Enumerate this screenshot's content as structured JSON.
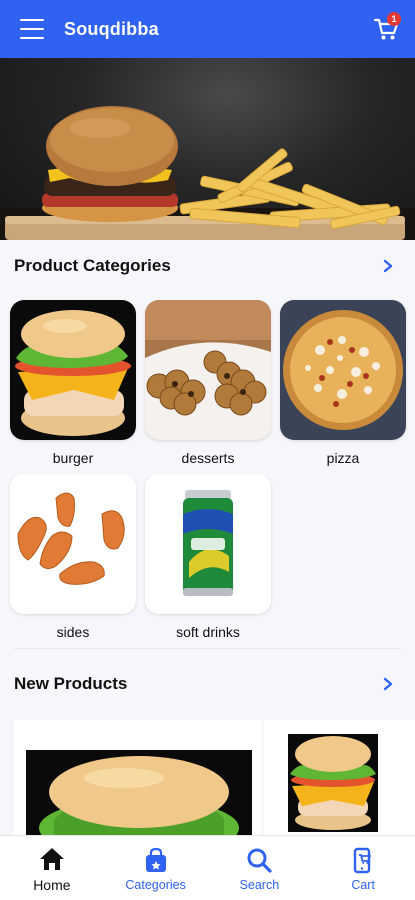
{
  "appbar": {
    "title": "Souqdibba",
    "cart_count": "1"
  },
  "categories": {
    "title": "Product Categories",
    "items": [
      {
        "label": "burger",
        "icon": "burger-image"
      },
      {
        "label": "desserts",
        "icon": "desserts-image"
      },
      {
        "label": "pizza",
        "icon": "pizza-image"
      },
      {
        "label": "sides",
        "icon": "chicken-wings-image"
      },
      {
        "label": "soft drinks",
        "icon": "sprite-can-image"
      }
    ]
  },
  "new_products": {
    "title": "New Products"
  },
  "nav": {
    "items": [
      {
        "label": "Home",
        "icon": "home-icon",
        "active": true
      },
      {
        "label": "Categories",
        "icon": "shopping-bag-icon",
        "active": false
      },
      {
        "label": "Search",
        "icon": "search-icon",
        "active": false
      },
      {
        "label": "Cart",
        "icon": "mobile-cart-icon",
        "active": false
      }
    ]
  },
  "colors": {
    "primary": "#2f62f0",
    "badge": "#e53935",
    "background": "#f6f7fb"
  }
}
